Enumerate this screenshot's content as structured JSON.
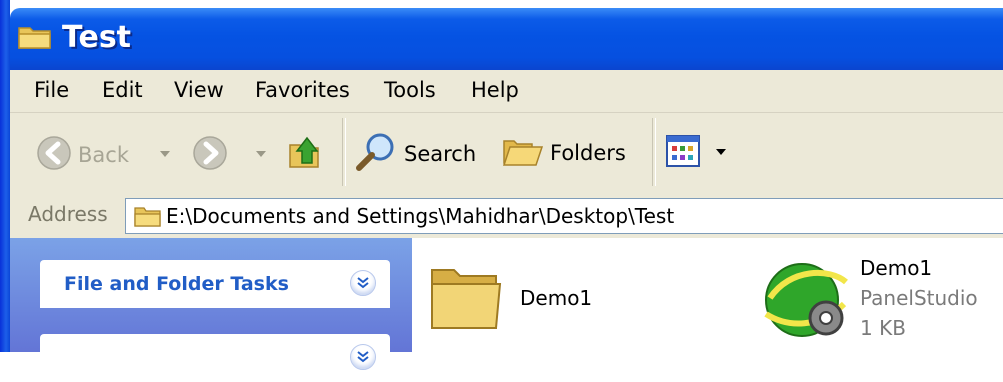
{
  "window": {
    "title": "Test",
    "title_icon": "folder-icon"
  },
  "menubar": {
    "items": [
      "File",
      "Edit",
      "View",
      "Favorites",
      "Tools",
      "Help"
    ]
  },
  "toolbar": {
    "back_label": "Back",
    "search_label": "Search",
    "folders_label": "Folders",
    "icons": [
      "back-arrow-icon",
      "forward-arrow-icon",
      "folder-up-icon",
      "magnifier-icon",
      "folders-icon",
      "views-icon"
    ]
  },
  "address": {
    "label": "Address",
    "value": "E:\\Documents and Settings\\Mahidhar\\Desktop\\Test"
  },
  "taskpane": {
    "sections": [
      {
        "title": "File and Folder Tasks"
      },
      {
        "title": ""
      }
    ]
  },
  "files": [
    {
      "name": "Demo1",
      "icon": "folder-icon"
    },
    {
      "name": "Demo1",
      "type": "PanelStudio",
      "size": "1 KB",
      "icon": "panelstudio-icon"
    }
  ],
  "colors": {
    "titlebar": "#0553e3",
    "chrome": "#ece9d8",
    "taskpane": "#7ba2e7",
    "task_title": "#215dc6"
  }
}
